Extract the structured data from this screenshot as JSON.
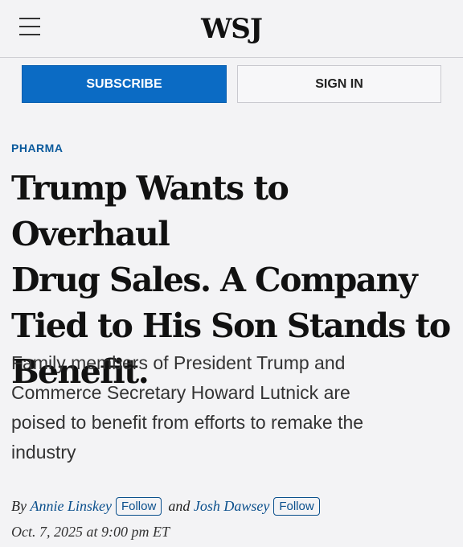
{
  "header": {
    "logo": "WSJ",
    "subscribe_label": "SUBSCRIBE",
    "signin_label": "SIGN IN"
  },
  "article": {
    "section": "PHARMA",
    "headline_lines": [
      "Trump Wants to Overhaul",
      "Drug Sales. A Company",
      "Tied to His Son Stands to",
      "Benefit."
    ],
    "dek_lines": [
      "Family members of President Trump and",
      "Commerce Secretary Howard Lutnick are",
      "poised to benefit from efforts to remake the",
      "industry"
    ],
    "byline": {
      "by": "By",
      "author1": "Annie Linskey",
      "follow1": "Follow",
      "and": "and",
      "author2": "Josh Dawsey",
      "follow2": "Follow"
    },
    "dateline": "Oct. 7, 2025 at 9:00 pm ET"
  },
  "colors": {
    "accent_blue": "#0b6bc4",
    "section_blue": "#0a5a9c",
    "background": "#f3f3f5"
  },
  "icons": {
    "menu": "hamburger-menu-icon"
  }
}
